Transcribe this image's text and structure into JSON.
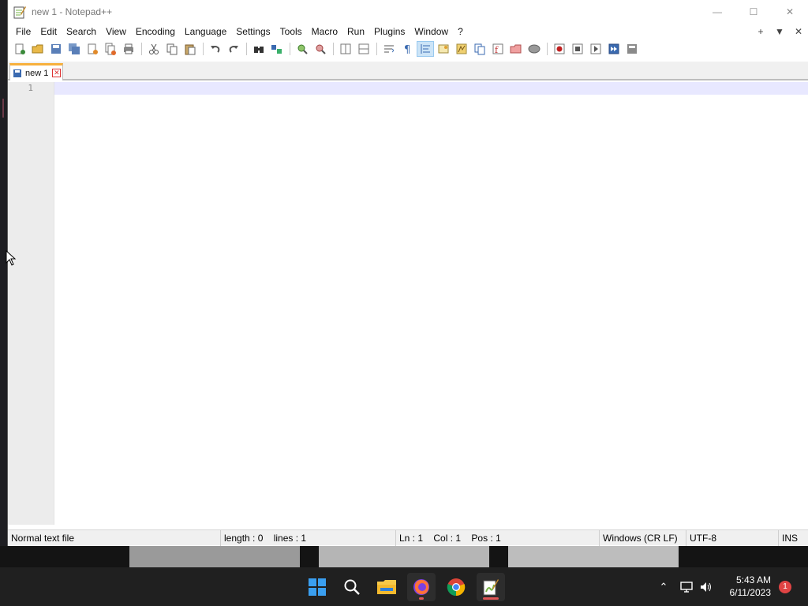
{
  "window": {
    "title": "new 1 - Notepad++",
    "controls": {
      "minimize": "—",
      "maximize": "☐",
      "close": "✕"
    }
  },
  "menu": {
    "items": [
      "File",
      "Edit",
      "Search",
      "View",
      "Encoding",
      "Language",
      "Settings",
      "Tools",
      "Macro",
      "Run",
      "Plugins",
      "Window",
      "?"
    ],
    "right": {
      "add": "+",
      "dropdown": "▼",
      "close": "✕"
    }
  },
  "tabs": [
    {
      "label": "new 1"
    }
  ],
  "editor": {
    "line_numbers": [
      "1"
    ]
  },
  "status": {
    "file_type": "Normal text file",
    "length": "length : 0",
    "lines": "lines : 1",
    "ln": "Ln : 1",
    "col": "Col : 1",
    "pos": "Pos : 1",
    "eol": "Windows (CR LF)",
    "encoding": "UTF-8",
    "mode": "INS"
  },
  "taskbar": {
    "time": "5:43 AM",
    "date": "6/11/2023",
    "notifications": "1"
  },
  "colors": {
    "tab_accent": "#f7b03c",
    "current_line": "#e8e8ff",
    "taskbar": "#202020",
    "notification": "#e04444"
  }
}
